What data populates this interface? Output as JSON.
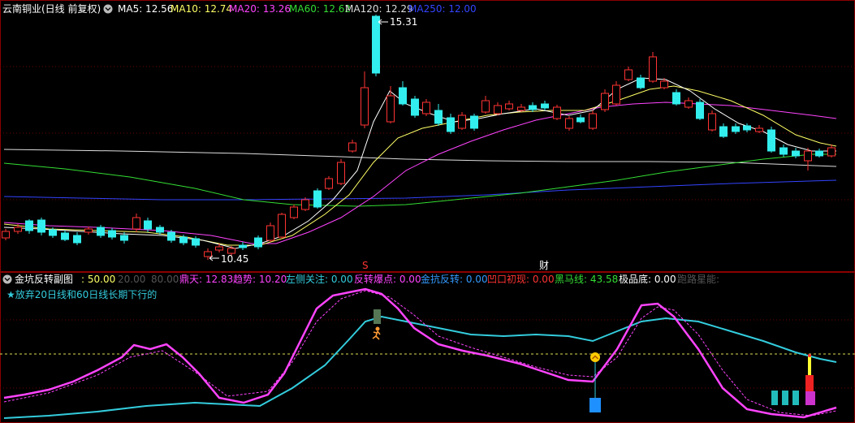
{
  "header": {
    "title": "云南铜业(日线 前复权)",
    "items": [
      {
        "label": "MA5: 12.56",
        "color": "#ffffff"
      },
      {
        "label": "MA10: 12.74",
        "color": "#ffff66"
      },
      {
        "label": "MA20: 13.26",
        "color": "#ff44ff"
      },
      {
        "label": "MA60: 12.62",
        "color": "#33dd33"
      },
      {
        "label": "MA120: 12.29",
        "color": "#dddddd"
      },
      {
        "label": "MA250: 12.00",
        "color": "#3344ff"
      }
    ]
  },
  "main_chart": {
    "high_label": "15.31",
    "low_label": "10.45",
    "marker_s": "S",
    "marker_cai": "财"
  },
  "sub_header": {
    "title": "金坑反转副图",
    "items": [
      {
        "label": ": 50.00",
        "color": "#ffff66"
      },
      {
        "label": "20.00",
        "color": "#555555"
      },
      {
        "label": "80.00",
        "color": "#555555"
      },
      {
        "label": "鼎天: 12.83",
        "color": "#ff44ff"
      },
      {
        "label": "趋势: 10.20",
        "color": "#ff44ff"
      },
      {
        "label": "左侧关注: 0.00",
        "color": "#33ccdd"
      },
      {
        "label": "反转爆点: 0.00",
        "color": "#ff44ff"
      },
      {
        "label": "金抗反转: 0.00",
        "color": "#3399ff"
      },
      {
        "label": "凹口初现: 0.00",
        "color": "#ff3333"
      },
      {
        "label": "黑马线: 43.58",
        "color": "#33dd33"
      },
      {
        "label": "极品底: 0.00",
        "color": "#ffffff"
      },
      {
        "label": "跑路星能: ",
        "color": "#555555"
      }
    ],
    "note": "★放弃20日线和60日线长期下行的"
  },
  "colors": {
    "up": "#ff3333",
    "down": "#33eeee",
    "grid": "#8b0000",
    "ma5": "#ffffff",
    "ma10": "#ffff66",
    "ma20": "#ff44ff",
    "ma60": "#33dd33",
    "ma120": "#dddddd",
    "ma250": "#3344ff",
    "trend": "#ff44ff",
    "cyan": "#33ccdd"
  }
}
